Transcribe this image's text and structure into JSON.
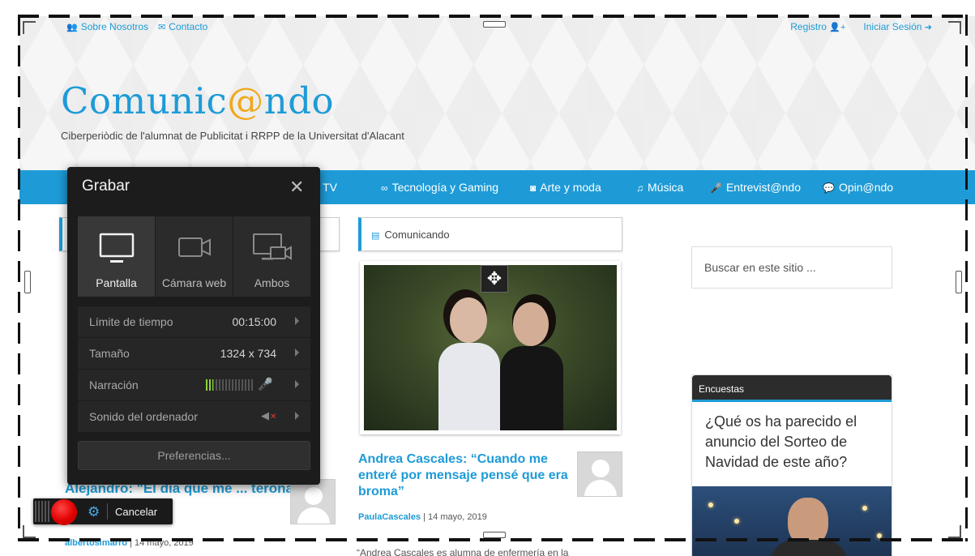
{
  "site": {
    "topbar": {
      "about": "Sobre Nosotros",
      "contact": "Contacto",
      "register": "Registro",
      "login": "Iniciar Sesión"
    },
    "brand": {
      "pre": "Comunic",
      "at": "@",
      "post": "ndo"
    },
    "tagline": "Ciberperiòdic de l'alumnat de Publicitat i RRPP de la Universitat d'Alacant",
    "nav": [
      {
        "label": "ne y TV",
        "icon": "tv-icon"
      },
      {
        "label": "Tecnología y Gaming",
        "icon": "gamepad-icon"
      },
      {
        "label": "Arte y moda",
        "icon": "camera-icon"
      },
      {
        "label": "Música",
        "icon": "music-icon"
      },
      {
        "label": "Entrevist@ndo",
        "icon": "microphone-icon"
      },
      {
        "label": "Opin@ndo",
        "icon": "comment-icon"
      }
    ],
    "section_center": "Comunicando",
    "article_center": {
      "title": "Andrea Cascales: “Cuando me enteré por mensaje pensé que era broma”",
      "author": "PaulaCascales",
      "date": "14 mayo, 2019",
      "excerpt": "“Andrea Cascales es alumna de enfermería en la"
    },
    "article_left": {
      "title": "Alejandro: \"El día que me ... terona fue un ... e\"",
      "author": "albertosimarro",
      "date": "14 mayo, 2019"
    },
    "search_placeholder": "Buscar en este sitio ...",
    "poll": {
      "header": "Encuestas",
      "question": "¿Qué os ha parecido el anuncio del Sorteo de Navidad de este año?"
    },
    "accent_color": "#1e9bd7",
    "brand_at_color": "#f0a81c"
  },
  "recorder": {
    "title": "Grabar",
    "modes": [
      {
        "label": "Pantalla",
        "icon": "monitor-icon",
        "active": true
      },
      {
        "label": "Cámara web",
        "icon": "webcam-icon",
        "active": false
      },
      {
        "label": "Ambos",
        "icon": "monitor-webcam-icon",
        "active": false
      }
    ],
    "time_limit": {
      "label": "Límite de tiempo",
      "value": "00:15:00"
    },
    "size": {
      "label": "Tamaño",
      "value": "1324 x 734"
    },
    "narration": {
      "label": "Narración",
      "level": 0.15
    },
    "computer_audio": {
      "label": "Sonido del ordenador",
      "muted": true
    },
    "preferences": "Preferencias...",
    "cancel": "Cancelar",
    "record_color": "#e00000"
  }
}
